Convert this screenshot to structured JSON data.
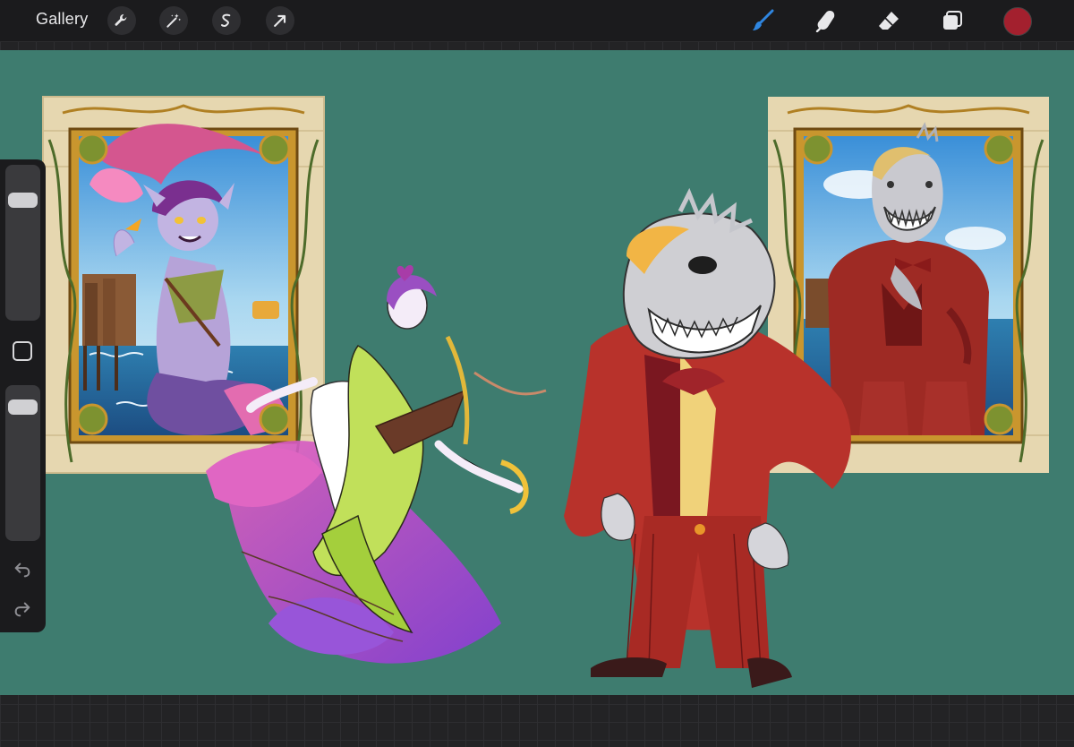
{
  "toolbar": {
    "gallery_label": "Gallery",
    "actions": [
      {
        "name": "actions-wrench",
        "icon": "wrench-icon"
      },
      {
        "name": "adjustments-wand",
        "icon": "magic-wand-icon"
      },
      {
        "name": "selection",
        "icon": "selection-s-icon"
      },
      {
        "name": "transform",
        "icon": "arrow-cursor-icon"
      }
    ],
    "tools": [
      {
        "name": "brush",
        "icon": "paintbrush-icon",
        "active": true
      },
      {
        "name": "smudge",
        "icon": "smudge-finger-icon",
        "active": false
      },
      {
        "name": "eraser",
        "icon": "eraser-icon",
        "active": false
      },
      {
        "name": "layers",
        "icon": "layers-icon",
        "active": false
      }
    ],
    "active_color": "#a3202e"
  },
  "sidebar": {
    "brush_size_level": 0.82,
    "opacity_level": 0.92,
    "undo_icon": "undo-arrow-icon",
    "redo_icon": "redo-arrow-icon"
  },
  "colors": {
    "canvas_bg": "#3e7c6f",
    "frame_gold": "#c9962e",
    "active_tool_blue": "#2f86e0"
  }
}
